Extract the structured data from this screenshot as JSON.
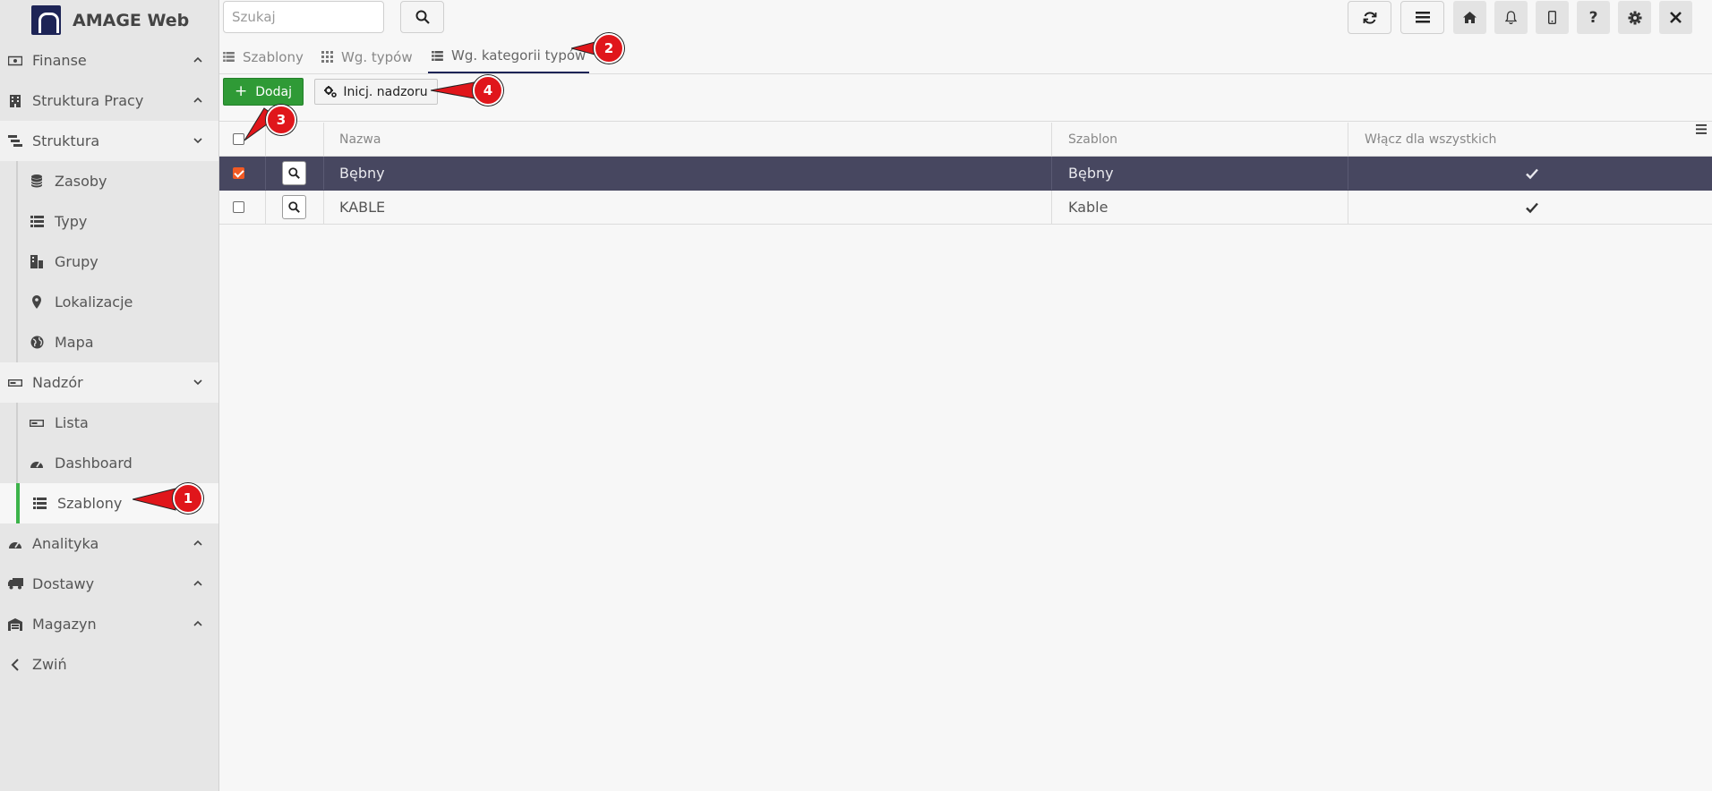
{
  "app": {
    "title": "AMAGE Web"
  },
  "search": {
    "placeholder": "Szukaj"
  },
  "sidebar": {
    "items": [
      {
        "label": "Finanse",
        "icon": "banknote-icon",
        "chevron": "up"
      },
      {
        "label": "Struktura Pracy",
        "icon": "building-icon",
        "chevron": "up"
      },
      {
        "label": "Struktura",
        "icon": "sitemap-icon",
        "chevron": "down"
      },
      {
        "label": "Nadzór",
        "icon": "hdd-icon",
        "chevron": "down"
      },
      {
        "label": "Analityka",
        "icon": "gauge-icon",
        "chevron": "up"
      },
      {
        "label": "Dostawy",
        "icon": "truck-icon",
        "chevron": "up"
      },
      {
        "label": "Magazyn",
        "icon": "warehouse-icon",
        "chevron": "up"
      },
      {
        "label": "Zwiń",
        "icon": "chevron-left-icon"
      }
    ],
    "struktura_sub": [
      {
        "label": "Zasoby",
        "icon": "database-icon"
      },
      {
        "label": "Typy",
        "icon": "list-icon"
      },
      {
        "label": "Grupy",
        "icon": "group-icon"
      },
      {
        "label": "Lokalizacje",
        "icon": "map-marker-icon"
      },
      {
        "label": "Mapa",
        "icon": "globe-icon"
      }
    ],
    "nadzor_sub": [
      {
        "label": "Lista",
        "icon": "hdd-icon"
      },
      {
        "label": "Dashboard",
        "icon": "gauge-icon"
      },
      {
        "label": "Szablony",
        "icon": "list-icon",
        "active": true
      }
    ]
  },
  "tabs": [
    {
      "label": "Szablony",
      "icon": "list-icon"
    },
    {
      "label": "Wg. typów",
      "icon": "grid-icon"
    },
    {
      "label": "Wg. kategorii typów",
      "icon": "list-icon",
      "active": true
    }
  ],
  "toolbar": {
    "add_label": "Dodaj",
    "init_label": "Inicj. nadzoru"
  },
  "table": {
    "columns": [
      "Nazwa",
      "Szablon",
      "Włącz dla wszystkich"
    ],
    "rows": [
      {
        "nazwa": "Bębny",
        "szablon": "Bębny",
        "wlacz": true,
        "checked": true,
        "selected": true
      },
      {
        "nazwa": "KABLE",
        "szablon": "Kable",
        "wlacz": true,
        "checked": false,
        "selected": false
      }
    ]
  },
  "annotations": [
    "1",
    "2",
    "3",
    "4"
  ],
  "colors": {
    "brand": "#1d2456",
    "accent_green": "#2f9a36",
    "active_bar": "#3cb34a",
    "selected_row": "#474760",
    "checkbox_on": "#f15a24",
    "callout": "#e0161b"
  }
}
